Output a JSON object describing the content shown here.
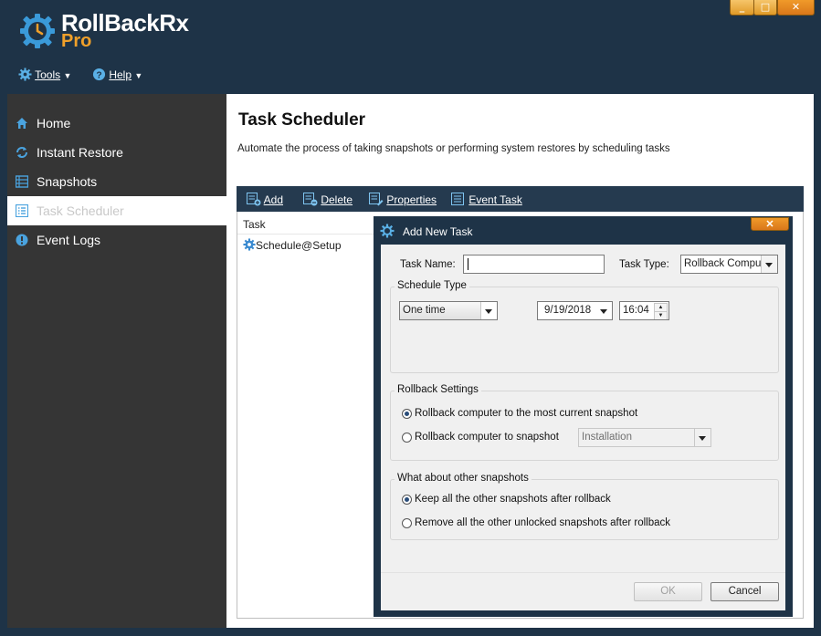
{
  "app": {
    "logo_main": "RollBackRx",
    "logo_sub": "Pro"
  },
  "window_controls": {
    "minimize": "_",
    "maximize": "□",
    "close": "✕"
  },
  "menu": {
    "tools": "Tools",
    "help": "Help"
  },
  "sidebar": {
    "items": [
      {
        "label": "Home",
        "icon": "home-icon"
      },
      {
        "label": "Instant Restore",
        "icon": "instant-restore-icon"
      },
      {
        "label": "Snapshots",
        "icon": "snapshots-icon"
      },
      {
        "label": "Task Scheduler",
        "icon": "task-list-icon",
        "active": true
      },
      {
        "label": "Event Logs",
        "icon": "alert-icon"
      }
    ]
  },
  "main": {
    "title": "Task Scheduler",
    "description": "Automate the process of taking snapshots or performing system restores by scheduling tasks",
    "toolbar": {
      "add": "Add",
      "delete": "Delete",
      "properties": "Properties",
      "event_task": "Event Task"
    },
    "table": {
      "column": "Task",
      "rows": [
        "Schedule@Setup"
      ]
    }
  },
  "dialog": {
    "title": "Add New Task",
    "close": "✕",
    "task_name_label": "Task Name:",
    "task_name_value": "",
    "task_type_label": "Task Type:",
    "task_type_value": "Rollback Computer",
    "schedule_type": {
      "title": "Schedule Type",
      "frequency": "One time",
      "date": "9/19/2018",
      "time": "16:04"
    },
    "rollback_settings": {
      "title": "Rollback Settings",
      "option_current": "Rollback computer to the most current snapshot",
      "option_snapshot": "Rollback computer to snapshot",
      "snapshot_value": "Installation",
      "selected": "current"
    },
    "other_snapshots": {
      "title": "What about other snapshots",
      "option_keep": "Keep all the other snapshots after rollback",
      "option_remove": "Remove all the other unlocked snapshots after rollback",
      "selected": "keep"
    },
    "ok": "OK",
    "cancel": "Cancel"
  },
  "colors": {
    "background": "#1e3347",
    "sidebar": "#353535",
    "accent": "#f0a02a",
    "toolbar": "#253a4f"
  }
}
